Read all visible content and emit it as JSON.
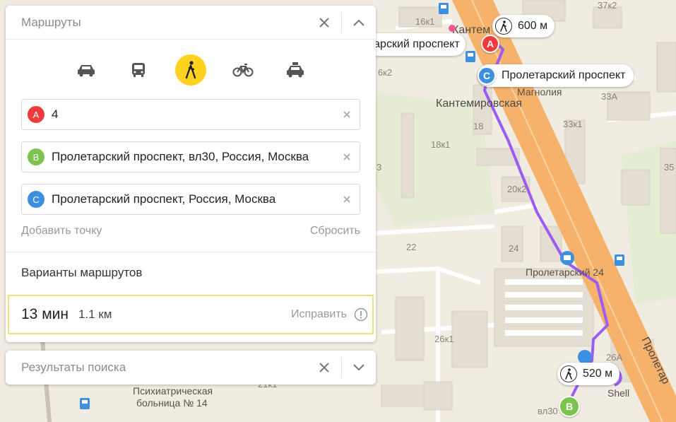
{
  "panel": {
    "title": "Маршруты",
    "transport_modes": [
      "car",
      "bus",
      "pedestrian",
      "bicycle",
      "taxi"
    ],
    "active_mode": "pedestrian",
    "points": [
      {
        "letter": "A",
        "value": "4",
        "color": "#ef3b3b"
      },
      {
        "letter": "B",
        "value": "Пролетарский проспект, вл30, Россия, Москва",
        "color": "#7cc44e"
      },
      {
        "letter": "C",
        "value": "Пролетарский проспект, Россия, Москва",
        "color": "#3d8fe0"
      }
    ],
    "add_point": "Добавить точку",
    "reset": "Сбросить",
    "variants_title": "Варианты маршрутов",
    "route": {
      "time": "13 мин",
      "distance": "1.1 км",
      "fix": "Исправить"
    }
  },
  "search_panel": {
    "title": "Результаты поиска"
  },
  "map": {
    "badges": {
      "top": "600 м",
      "bottom": "520 м"
    },
    "callouts": {
      "a": "тарский проспект",
      "c": "Пролетарский проспект"
    },
    "labels": {
      "kantem_short": "Кантем",
      "kantemirovskaya": "Кантемировская",
      "magnolia": "Магнолия",
      "proletarsky24": "Пролетарский 24",
      "street": "Пролетар",
      "hospital1": "Психиатрическая",
      "hospital2": "больница № 14",
      "shell": "Shell",
      "vl30": "вл30",
      "h16k1": "16к1",
      "h6k2": "6к2",
      "h18": "18",
      "h18k1": "18к1",
      "h3": "3",
      "h20k2": "20к2",
      "h22": "22",
      "h24": "24",
      "h26k1": "26к1",
      "h26a": "26А",
      "h33a": "33А",
      "h33k1": "33к1",
      "h35": "35",
      "h37k2": "37к2",
      "h21k1": "21к1"
    },
    "route_color": "#9b5cf5",
    "road_color": "#f6b26b"
  }
}
